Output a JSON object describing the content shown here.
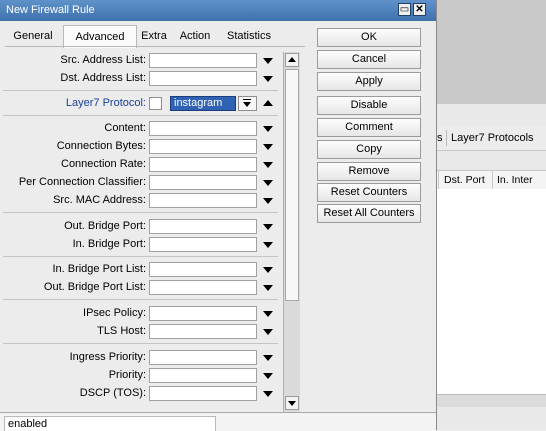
{
  "background": {
    "tabs": {
      "partial": "s",
      "active": "Layer7 Protocols"
    },
    "columns": [
      "Dst. Port",
      "In. Inter"
    ]
  },
  "dialog": {
    "title": "New Firewall Rule",
    "tabs": [
      "General",
      "Advanced",
      "Extra",
      "Action",
      "Statistics"
    ],
    "active_tab": "Advanced",
    "fields": [
      {
        "label": "Src. Address List:",
        "value": ""
      },
      {
        "label": "Dst. Address List:",
        "value": ""
      },
      {
        "label": "Content:",
        "value": ""
      },
      {
        "label": "Connection Bytes:",
        "value": ""
      },
      {
        "label": "Connection Rate:",
        "value": ""
      },
      {
        "label": "Per Connection Classifier:",
        "value": ""
      },
      {
        "label": "Src. MAC Address:",
        "value": ""
      },
      {
        "label": "Out. Bridge Port:",
        "value": ""
      },
      {
        "label": "In. Bridge Port:",
        "value": ""
      },
      {
        "label": "In. Bridge Port List:",
        "value": ""
      },
      {
        "label": "Out. Bridge Port List:",
        "value": ""
      },
      {
        "label": "IPsec Policy:",
        "value": ""
      },
      {
        "label": "TLS Host:",
        "value": ""
      },
      {
        "label": "Ingress Priority:",
        "value": ""
      },
      {
        "label": "Priority:",
        "value": ""
      },
      {
        "label": "DSCP (TOS):",
        "value": ""
      }
    ],
    "layer7": {
      "label": "Layer7 Protocol:",
      "value": "instagram",
      "negate": false
    },
    "buttons": [
      "OK",
      "Cancel",
      "Apply",
      "Disable",
      "Comment",
      "Copy",
      "Remove",
      "Reset Counters",
      "Reset All Counters"
    ],
    "status": "enabled"
  }
}
